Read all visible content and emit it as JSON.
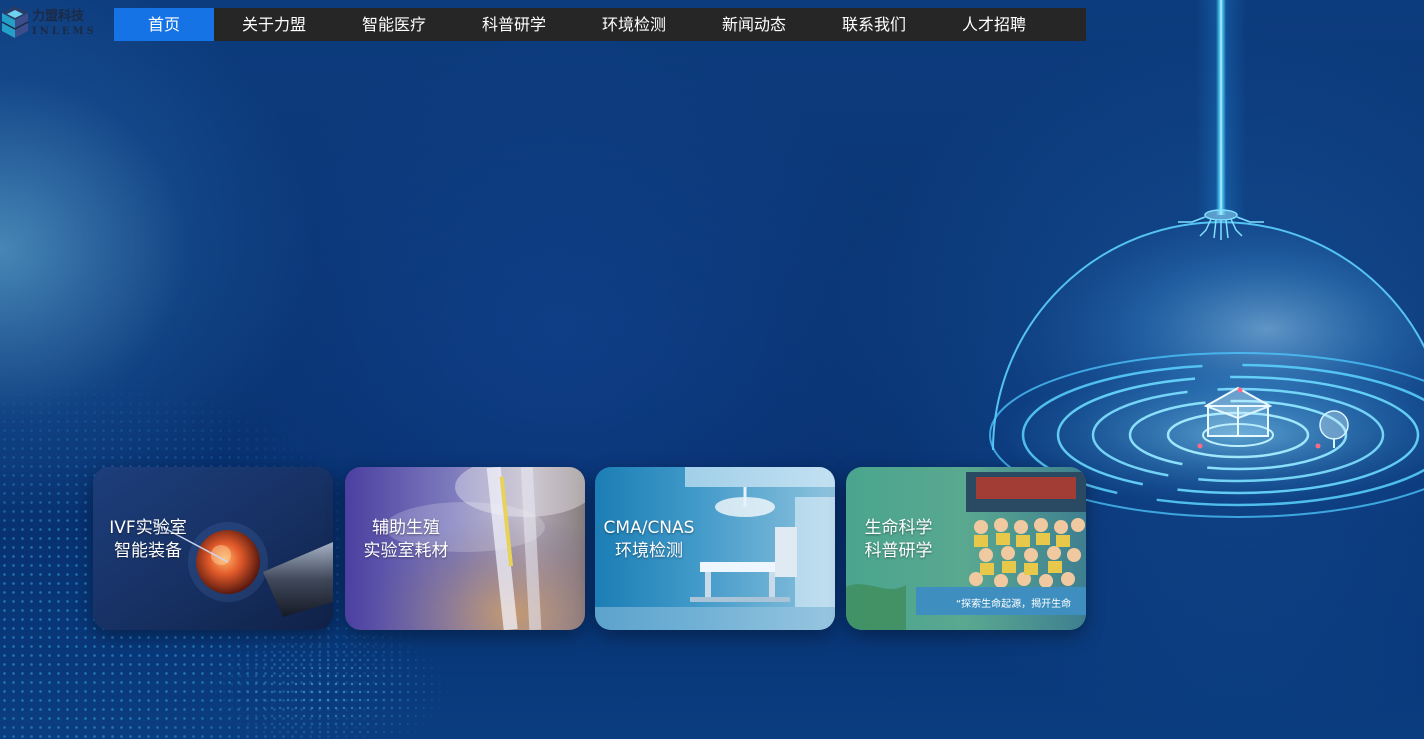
{
  "logo": {
    "name_cn": "力盟科技",
    "name_en": "INLEMS"
  },
  "nav": {
    "items": [
      {
        "label": "首页",
        "active": true
      },
      {
        "label": "关于力盟"
      },
      {
        "label": "智能医疗"
      },
      {
        "label": "科普研学"
      },
      {
        "label": "环境检测"
      },
      {
        "label": "新闻动态"
      },
      {
        "label": "联系我们"
      },
      {
        "label": "人才招聘"
      }
    ]
  },
  "cards": [
    {
      "line1": "IVF实验室",
      "line2": "智能装备",
      "image": "ivf-egg-injection-photo"
    },
    {
      "line1": "辅助生殖",
      "line2": "实验室耗材",
      "image": "cryo-straw-photo"
    },
    {
      "line1": "CMA/CNAS",
      "line2": "环境检测",
      "image": "operating-room-photo"
    },
    {
      "line1": "生命科学",
      "line2": "科普研学",
      "image": "student-group-photo"
    }
  ],
  "banner_text": "“探索生命起源，揭开生命",
  "colors": {
    "nav_bg": "#262626",
    "nav_active": "#1673e6",
    "page_bg": "#0a3574",
    "beam": "#5fd6ff"
  }
}
